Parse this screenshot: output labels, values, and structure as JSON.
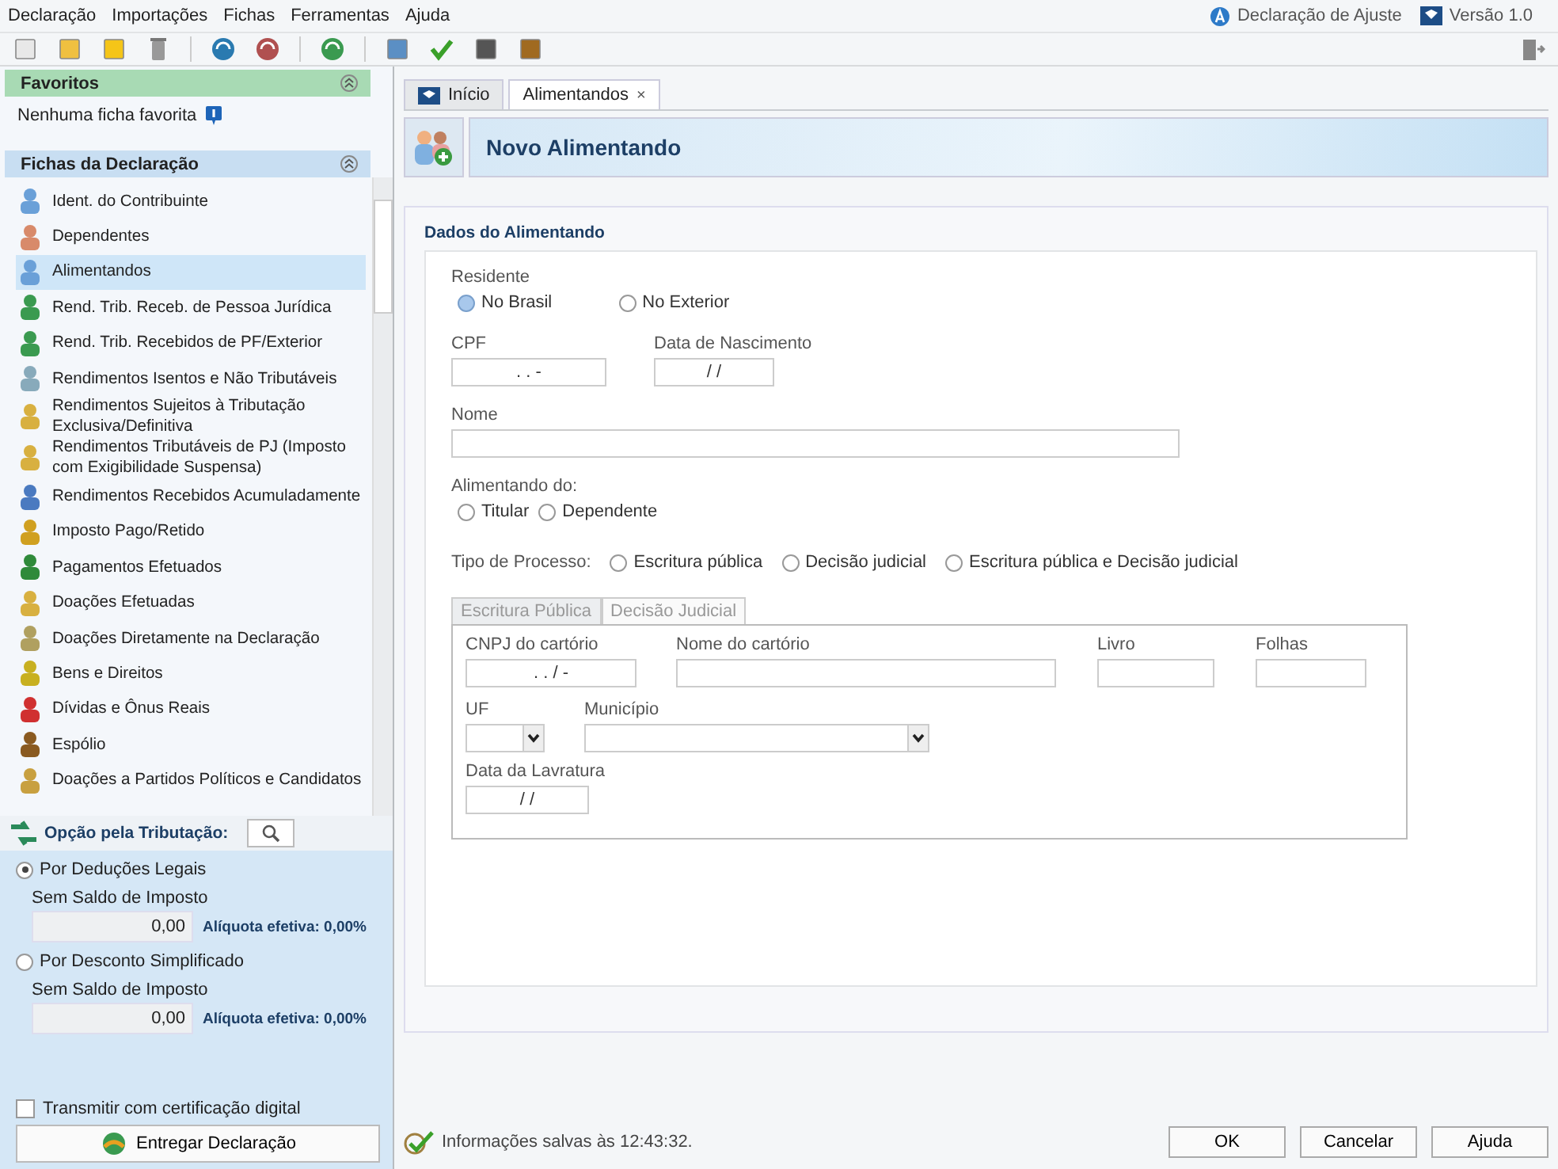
{
  "menu": [
    "Declaração",
    "Importações",
    "Fichas",
    "Ferramentas",
    "Ajuda"
  ],
  "header_info": {
    "mode": "Declaração de Ajuste",
    "version": "Versão 1.0"
  },
  "favorites": {
    "title": "Favoritos",
    "empty_text": "Nenhuma ficha favorita"
  },
  "fichas": {
    "title": "Fichas da Declaração",
    "items": [
      {
        "label": "Ident. do Contribuinte",
        "selected": false
      },
      {
        "label": "Dependentes",
        "selected": false
      },
      {
        "label": "Alimentandos",
        "selected": true
      },
      {
        "label": "Rend. Trib. Receb. de Pessoa Jurídica",
        "selected": false
      },
      {
        "label": "Rend. Trib. Recebidos de PF/Exterior",
        "selected": false
      },
      {
        "label": "Rendimentos Isentos e Não Tributáveis",
        "selected": false
      },
      {
        "label": "Rendimentos Sujeitos à Tributação Exclusiva/Definitiva",
        "selected": false
      },
      {
        "label": "Rendimentos Tributáveis de PJ (Imposto com Exigibilidade Suspensa)",
        "selected": false
      },
      {
        "label": "Rendimentos Recebidos Acumuladamente",
        "selected": false
      },
      {
        "label": "Imposto Pago/Retido",
        "selected": false
      },
      {
        "label": "Pagamentos Efetuados",
        "selected": false
      },
      {
        "label": "Doações Efetuadas",
        "selected": false
      },
      {
        "label": "Doações Diretamente na Declaração",
        "selected": false
      },
      {
        "label": "Bens e Direitos",
        "selected": false
      },
      {
        "label": "Dívidas e Ônus Reais",
        "selected": false
      },
      {
        "label": "Espólio",
        "selected": false
      },
      {
        "label": "Doações a Partidos Políticos e Candidatos",
        "selected": false
      }
    ]
  },
  "tax_option": {
    "title": "Opção pela Tributação:",
    "options": [
      {
        "label": "Por Deduções Legais",
        "selected": true,
        "balance_label": "Sem Saldo de Imposto",
        "value": "0,00",
        "rate": "Alíquota efetiva: 0,00%"
      },
      {
        "label": "Por Desconto Simplificado",
        "selected": false,
        "balance_label": "Sem Saldo de Imposto",
        "value": "0,00",
        "rate": "Alíquota efetiva: 0,00%"
      }
    ],
    "certificate": {
      "label": "Transmitir com certificação digital",
      "checked": false
    },
    "submit": "Entregar Declaração"
  },
  "tabs": [
    {
      "label": "Início",
      "selected": false
    },
    {
      "label": "Alimentandos",
      "selected": true,
      "close": "×"
    }
  ],
  "page_title": "Novo Alimentando",
  "form": {
    "section_title": "Dados do Alimentando",
    "residente": {
      "label": "Residente",
      "options": [
        {
          "label": "No Brasil",
          "selected": false,
          "focused": true
        },
        {
          "label": "No Exterior",
          "selected": false,
          "focused": false
        }
      ]
    },
    "cpf": {
      "label": "CPF",
      "value": ". . -"
    },
    "nascimento": {
      "label": "Data de Nascimento",
      "value": "/ /"
    },
    "nome": {
      "label": "Nome"
    },
    "alimentando_do": {
      "label": "Alimentando do:",
      "options": [
        {
          "label": "Titular",
          "selected": false,
          "focused": false
        },
        {
          "label": "Dependente",
          "selected": false,
          "focused": false
        }
      ]
    },
    "tipo_processo": {
      "label": "Tipo de Processo:",
      "options": [
        {
          "label": "Escritura pública",
          "selected": false,
          "focused": false
        },
        {
          "label": "Decisão judicial",
          "selected": false,
          "focused": false
        },
        {
          "label": "Escritura pública e Decisão judicial",
          "selected": false,
          "focused": false
        }
      ]
    },
    "subtabs": [
      {
        "label": "Escritura Pública",
        "selected": true
      },
      {
        "label": "Decisão Judicial",
        "selected": false
      }
    ],
    "cnpj": {
      "label": "CNPJ do cartório",
      "value": ". . / -"
    },
    "nome_cartorio": {
      "label": "Nome do cartório"
    },
    "livro": {
      "label": "Livro"
    },
    "folhas": {
      "label": "Folhas"
    },
    "uf": {
      "label": "UF"
    },
    "municipio": {
      "label": "Município"
    },
    "data_lavratura": {
      "label": "Data da Lavratura",
      "value": "/ /"
    }
  },
  "status": "Informações salvas às 12:43:32.",
  "buttons": [
    "OK",
    "Cancelar",
    "Ajuda"
  ]
}
